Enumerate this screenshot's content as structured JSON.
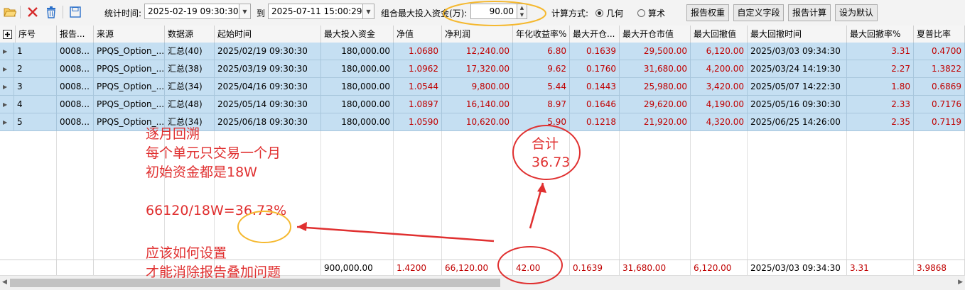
{
  "toolbar": {
    "icons": [
      "folder-open-icon",
      "delete-x-icon",
      "trash-icon",
      "save-icon"
    ],
    "stat_time_label": "统计时间:",
    "start_time": "2025-02-19 09:30:30",
    "to_label": "到",
    "end_time": "2025-07-11 15:00:29",
    "max_capital_label": "组合最大投入资金(万):",
    "max_capital_value": "90.00",
    "calc_method_label": "计算方式:",
    "radio_geometric": "几何",
    "radio_arithmetic": "算术",
    "selected_method": "几何",
    "btn_report_weight": "报告权重",
    "btn_custom_fields": "自定义字段",
    "btn_report_calc": "报告计算",
    "btn_set_default": "设为默认"
  },
  "table": {
    "columns": [
      "序号",
      "报告...",
      "来源",
      "数据源",
      "起始时间",
      "最大投入资金",
      "净值",
      "净利润",
      "年化收益率%",
      "最大开仓...",
      "最大开仓市值",
      "最大回撤值",
      "最大回撤时间",
      "最大回撤率%",
      "夏普比率"
    ],
    "rows": [
      [
        "1",
        "0008...",
        "PPQS_Option_...",
        "汇总(40)",
        "2025/02/19 09:30:30",
        "180,000.00",
        "1.0680",
        "12,240.00",
        "6.80",
        "0.1639",
        "29,500.00",
        "6,120.00",
        "2025/03/03 09:34:30",
        "3.31",
        "0.4700"
      ],
      [
        "2",
        "0008...",
        "PPQS_Option_...",
        "汇总(38)",
        "2025/03/19 09:30:30",
        "180,000.00",
        "1.0962",
        "17,320.00",
        "9.62",
        "0.1760",
        "31,680.00",
        "4,200.00",
        "2025/03/24 14:19:30",
        "2.27",
        "1.3822"
      ],
      [
        "3",
        "0008...",
        "PPQS_Option_...",
        "汇总(34)",
        "2025/04/16 09:30:30",
        "180,000.00",
        "1.0544",
        "9,800.00",
        "5.44",
        "0.1443",
        "25,980.00",
        "3,420.00",
        "2025/05/07 14:22:30",
        "1.80",
        "0.6869"
      ],
      [
        "4",
        "0008...",
        "PPQS_Option_...",
        "汇总(48)",
        "2025/05/14 09:30:30",
        "180,000.00",
        "1.0897",
        "16,140.00",
        "8.97",
        "0.1646",
        "29,620.00",
        "4,190.00",
        "2025/05/16 09:30:30",
        "2.33",
        "0.7176"
      ],
      [
        "5",
        "0008...",
        "PPQS_Option_...",
        "汇总(34)",
        "2025/06/18 09:30:30",
        "180,000.00",
        "1.0590",
        "10,620.00",
        "5.90",
        "0.1218",
        "21,920.00",
        "4,320.00",
        "2025/06/25 14:26:00",
        "2.35",
        "0.7119"
      ]
    ],
    "summary": [
      "",
      "",
      "",
      "",
      "",
      "900,000.00",
      "1.4200",
      "66,120.00",
      "42.00",
      "0.1639",
      "31,680.00",
      "6,120.00",
      "2025/03/03 09:34:30",
      "3.31",
      "3.9868"
    ]
  },
  "annotations": {
    "main_lines": [
      "逐月回溯",
      "每个单元只交易一个月",
      "初始资金都是18W",
      "",
      "66120/18W=36.73%"
    ],
    "total_lines": [
      "合计",
      "36.73"
    ],
    "question_lines": [
      "应该如何设置",
      "才能消除报告叠加问题"
    ]
  },
  "colors": {
    "row_selected": "#c5dff2",
    "value_red": "#c00000",
    "annotation_red": "#e03030",
    "highlight_orange": "#f5b82e"
  }
}
